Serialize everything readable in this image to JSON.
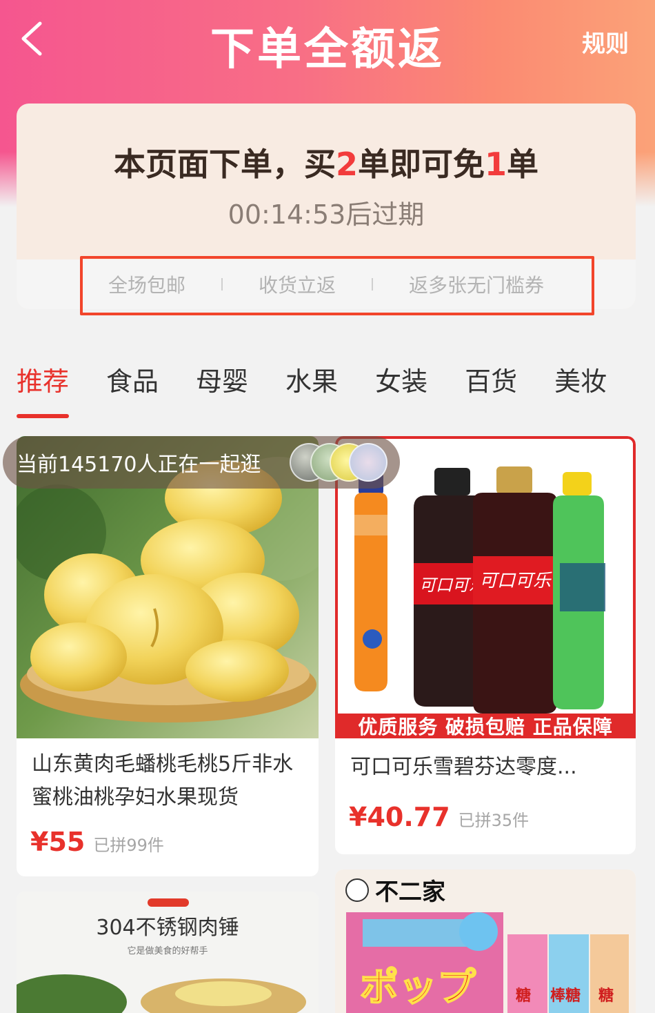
{
  "header": {
    "back_icon": "chevron-left-icon",
    "title": "下单全额返",
    "rules_label": "规则"
  },
  "promo": {
    "headline_prefix": "本页面下单，买",
    "buy_count": "2",
    "headline_mid": "单即可免",
    "free_count": "1",
    "headline_suffix": "单",
    "countdown": "00:14:53后过期",
    "benefits": [
      "全场包邮",
      "收货立返",
      "返多张无门槛券"
    ]
  },
  "tabs": [
    "推荐",
    "食品",
    "母婴",
    "水果",
    "女装",
    "百货",
    "美妆"
  ],
  "active_tab": 0,
  "live_banner": {
    "text": "当前145170人正在一起逛"
  },
  "products": [
    {
      "title": "山东黄肉毛蟠桃毛桃5斤非水蜜桃油桃孕妇水果现货",
      "price": "¥55",
      "sold": "已拼99件"
    },
    {
      "title": "可口可乐雪碧芬达零度...",
      "price": "¥40.77",
      "sold": "已拼35件",
      "badge": "优质服务 破损包赔 正品保障",
      "bottle_labels": [
        "可口可乐",
        "可口可乐"
      ]
    },
    {
      "image_text": "304不锈钢肉锤",
      "image_subtext": "它是做美食的好帮手"
    },
    {
      "image_text": "不二家",
      "candy_text": "ポップ",
      "side_labels": [
        "糖",
        "棒糖",
        "糖"
      ]
    }
  ],
  "colors": {
    "accent": "#e8312b",
    "header_gradient_start": "#f5568f",
    "header_gradient_end": "#fba278",
    "promo_bg": "#f8ebe2"
  }
}
